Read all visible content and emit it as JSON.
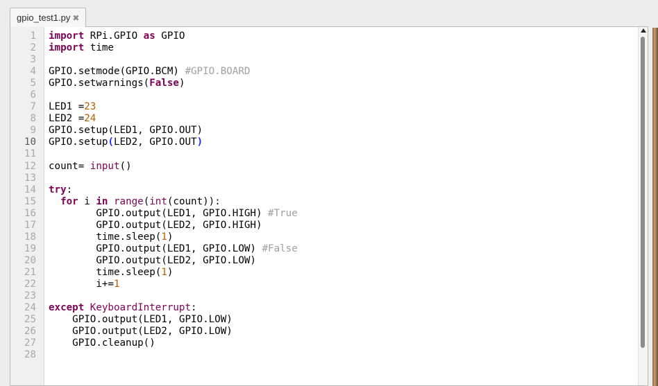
{
  "tab": {
    "label": "gpio_test1.py",
    "close_glyph": "✖"
  },
  "editor": {
    "current_line": 10,
    "lines": [
      {
        "n": "1",
        "tokens": [
          [
            "kw",
            "import"
          ],
          [
            "p",
            " RPi.GPIO "
          ],
          [
            "kw",
            "as"
          ],
          [
            "p",
            " GPIO"
          ]
        ]
      },
      {
        "n": "2",
        "tokens": [
          [
            "kw",
            "import"
          ],
          [
            "p",
            " time"
          ]
        ]
      },
      {
        "n": "3",
        "tokens": []
      },
      {
        "n": "4",
        "tokens": [
          [
            "p",
            "GPIO.setmode(GPIO.BCM) "
          ],
          [
            "cmt",
            "#GPIO.BOARD"
          ]
        ]
      },
      {
        "n": "5",
        "tokens": [
          [
            "p",
            "GPIO.setwarnings("
          ],
          [
            "kw",
            "False"
          ],
          [
            "p",
            ")"
          ]
        ]
      },
      {
        "n": "6",
        "tokens": []
      },
      {
        "n": "7",
        "tokens": [
          [
            "p",
            "LED1 ="
          ],
          [
            "num",
            "23"
          ]
        ]
      },
      {
        "n": "8",
        "tokens": [
          [
            "p",
            "LED2 ="
          ],
          [
            "num",
            "24"
          ]
        ]
      },
      {
        "n": "9",
        "tokens": [
          [
            "p",
            "GPIO.setup(LED1, GPIO.OUT)"
          ]
        ]
      },
      {
        "n": "10",
        "tokens": [
          [
            "p",
            "GPIO.setup"
          ],
          [
            "brace",
            "("
          ],
          [
            "p",
            "LED2, GPIO.OUT"
          ],
          [
            "brace",
            ")"
          ]
        ]
      },
      {
        "n": "11",
        "tokens": []
      },
      {
        "n": "12",
        "tokens": [
          [
            "p",
            "count= "
          ],
          [
            "bi",
            "input"
          ],
          [
            "p",
            "()"
          ]
        ]
      },
      {
        "n": "13",
        "tokens": []
      },
      {
        "n": "14",
        "tokens": [
          [
            "kw",
            "try"
          ],
          [
            "p",
            ":"
          ]
        ]
      },
      {
        "n": "15",
        "tokens": [
          [
            "p",
            "  "
          ],
          [
            "kw",
            "for"
          ],
          [
            "p",
            " i "
          ],
          [
            "kw",
            "in"
          ],
          [
            "p",
            " "
          ],
          [
            "bi",
            "range"
          ],
          [
            "p",
            "("
          ],
          [
            "bi",
            "int"
          ],
          [
            "p",
            "(count)):"
          ]
        ]
      },
      {
        "n": "16",
        "tokens": [
          [
            "p",
            "        GPIO.output(LED1, GPIO.HIGH) "
          ],
          [
            "cmt",
            "#True"
          ]
        ]
      },
      {
        "n": "17",
        "tokens": [
          [
            "p",
            "        GPIO.output(LED2, GPIO.HIGH)"
          ]
        ]
      },
      {
        "n": "18",
        "tokens": [
          [
            "p",
            "        time.sleep("
          ],
          [
            "num",
            "1"
          ],
          [
            "p",
            ")"
          ]
        ]
      },
      {
        "n": "19",
        "tokens": [
          [
            "p",
            "        GPIO.output(LED1, GPIO.LOW) "
          ],
          [
            "cmt",
            "#False"
          ]
        ]
      },
      {
        "n": "20",
        "tokens": [
          [
            "p",
            "        GPIO.output(LED2, GPIO.LOW)"
          ]
        ]
      },
      {
        "n": "21",
        "tokens": [
          [
            "p",
            "        time.sleep("
          ],
          [
            "num",
            "1"
          ],
          [
            "p",
            ")"
          ]
        ]
      },
      {
        "n": "22",
        "tokens": [
          [
            "p",
            "        i+="
          ],
          [
            "num",
            "1"
          ]
        ]
      },
      {
        "n": "23",
        "tokens": []
      },
      {
        "n": "24",
        "tokens": [
          [
            "kw",
            "except"
          ],
          [
            "p",
            " "
          ],
          [
            "bi",
            "KeyboardInterrupt"
          ],
          [
            "p",
            ":"
          ]
        ]
      },
      {
        "n": "25",
        "tokens": [
          [
            "p",
            "    GPIO.output(LED1, GPIO.LOW)"
          ]
        ]
      },
      {
        "n": "26",
        "tokens": [
          [
            "p",
            "    GPIO.output(LED2, GPIO.LOW)"
          ]
        ]
      },
      {
        "n": "27",
        "tokens": [
          [
            "p",
            "    GPIO.cleanup()"
          ]
        ]
      },
      {
        "n": "28",
        "tokens": []
      }
    ]
  },
  "colors": {
    "keyword": "#7f0055",
    "number": "#b85c00",
    "comment": "#a0a0a0",
    "brace_match": "#1b2cff",
    "line_number": "#a8a8a8"
  },
  "icons": {
    "tab_close": "close-icon",
    "scroll_up": "arrow-up-icon"
  }
}
